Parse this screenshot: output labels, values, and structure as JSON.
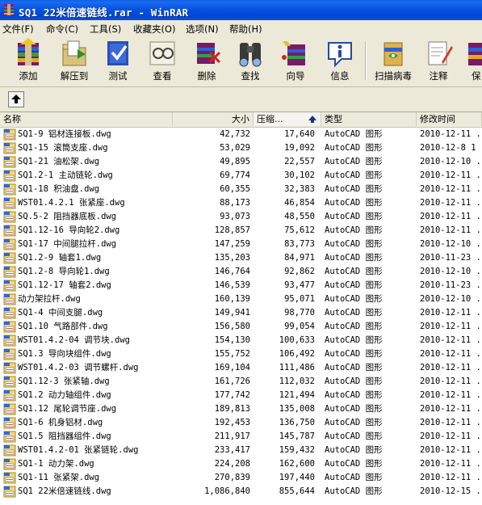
{
  "window": {
    "title": "SQ1  22米倍速链线.rar - WinRAR"
  },
  "menu": [
    {
      "label": "文件(F)"
    },
    {
      "label": "命令(C)"
    },
    {
      "label": "工具(S)"
    },
    {
      "label": "收藏夹(O)"
    },
    {
      "label": "选项(N)"
    },
    {
      "label": "帮助(H)"
    }
  ],
  "toolbar": [
    {
      "label": "添加",
      "icon": "add-archive-icon"
    },
    {
      "label": "解压到",
      "icon": "extract-to-icon"
    },
    {
      "label": "测试",
      "icon": "test-icon"
    },
    {
      "label": "查看",
      "icon": "view-icon"
    },
    {
      "label": "删除",
      "icon": "delete-icon"
    },
    {
      "label": "查找",
      "icon": "find-icon"
    },
    {
      "label": "向导",
      "icon": "wizard-icon"
    },
    {
      "label": "信息",
      "icon": "info-icon"
    },
    {
      "label": "扫描病毒",
      "icon": "virus-scan-icon"
    },
    {
      "label": "注释",
      "icon": "comment-icon"
    },
    {
      "label": "保",
      "icon": "protect-icon"
    }
  ],
  "columns": {
    "name": "名称",
    "size": "大小",
    "packed": "压缩...",
    "type": "类型",
    "modified": "修改时间"
  },
  "files": [
    {
      "name": "SQ1-9  铝材连接板.dwg",
      "size": "42,732",
      "packed": "17,640",
      "type": "AutoCAD 图形",
      "modified": "2010-12-11 ."
    },
    {
      "name": "SQ1-15  滚筒支座.dwg",
      "size": "53,029",
      "packed": "19,092",
      "type": "AutoCAD 图形",
      "modified": "2010-12-8 1"
    },
    {
      "name": "SQ1-21  油松架.dwg",
      "size": "49,895",
      "packed": "22,557",
      "type": "AutoCAD 图形",
      "modified": "2010-12-10 ."
    },
    {
      "name": "SQ1.2-1  主动链轮.dwg",
      "size": "69,774",
      "packed": "30,102",
      "type": "AutoCAD 图形",
      "modified": "2010-12-11 ."
    },
    {
      "name": "SQ1-18  积油盘.dwg",
      "size": "60,355",
      "packed": "32,383",
      "type": "AutoCAD 图形",
      "modified": "2010-12-11 ."
    },
    {
      "name": "WST01.4.2.1 张紧座.dwg",
      "size": "88,173",
      "packed": "46,854",
      "type": "AutoCAD 图形",
      "modified": "2010-12-11 ."
    },
    {
      "name": "SQ.5-2  阻挡器底板.dwg",
      "size": "93,073",
      "packed": "48,550",
      "type": "AutoCAD 图形",
      "modified": "2010-12-11 ."
    },
    {
      "name": "SQ1.12-16 导向轮2.dwg",
      "size": "128,857",
      "packed": "75,612",
      "type": "AutoCAD 图形",
      "modified": "2010-12-11 ."
    },
    {
      "name": "SQ1-17  中间腿拉杆.dwg",
      "size": "147,259",
      "packed": "83,773",
      "type": "AutoCAD 图形",
      "modified": "2010-12-10 ."
    },
    {
      "name": "SQ1.2-9  轴套1.dwg",
      "size": "135,203",
      "packed": "84,971",
      "type": "AutoCAD 图形",
      "modified": "2010-11-23 ."
    },
    {
      "name": "SQ1.2-8  导向轮1.dwg",
      "size": "146,764",
      "packed": "92,862",
      "type": "AutoCAD 图形",
      "modified": "2010-12-10 ."
    },
    {
      "name": "SQ1.12-17  轴套2.dwg",
      "size": "146,539",
      "packed": "93,477",
      "type": "AutoCAD 图形",
      "modified": "2010-11-23 ."
    },
    {
      "name": "动力架拉杆.dwg",
      "size": "160,139",
      "packed": "95,071",
      "type": "AutoCAD 图形",
      "modified": "2010-12-10 ."
    },
    {
      "name": "SQ1-4  中间支腿.dwg",
      "size": "149,941",
      "packed": "98,770",
      "type": "AutoCAD 图形",
      "modified": "2010-12-11 ."
    },
    {
      "name": "SQ1.10  气路部件.dwg",
      "size": "156,580",
      "packed": "99,054",
      "type": "AutoCAD 图形",
      "modified": "2010-12-11 ."
    },
    {
      "name": "WST01.4.2-04  调节块.dwg",
      "size": "154,130",
      "packed": "100,633",
      "type": "AutoCAD 图形",
      "modified": "2010-12-11 ."
    },
    {
      "name": "SQ1.3 导向块组件.dwg",
      "size": "155,752",
      "packed": "106,492",
      "type": "AutoCAD 图形",
      "modified": "2010-12-11 ."
    },
    {
      "name": "WST01.4.2-03 调节螺杆.dwg",
      "size": "169,104",
      "packed": "111,486",
      "type": "AutoCAD 图形",
      "modified": "2010-12-11 ."
    },
    {
      "name": " SQ1.12-3  张紧轴.dwg",
      "size": "161,726",
      "packed": "112,032",
      "type": "AutoCAD 图形",
      "modified": "2010-12-11 ."
    },
    {
      "name": "SQ1.2  动力轴组件.dwg",
      "size": "177,742",
      "packed": "121,494",
      "type": "AutoCAD 图形",
      "modified": "2010-12-11 ."
    },
    {
      "name": "SQ1.12  尾轮调节座.dwg",
      "size": "189,813",
      "packed": "135,008",
      "type": "AutoCAD 图形",
      "modified": "2010-12-11 ."
    },
    {
      "name": "SQ1-6 机身铝材.dwg",
      "size": "192,453",
      "packed": "136,750",
      "type": "AutoCAD 图形",
      "modified": "2010-12-11 ."
    },
    {
      "name": "SQ1.5  阻挡器组件.dwg",
      "size": "211,917",
      "packed": "145,787",
      "type": "AutoCAD 图形",
      "modified": "2010-12-11 ."
    },
    {
      "name": "WST01.4.2-01  张紧链轮.dwg",
      "size": "233,417",
      "packed": "159,432",
      "type": "AutoCAD 图形",
      "modified": "2010-12-11 ."
    },
    {
      "name": "SQ1-1  动力架.dwg",
      "size": "224,208",
      "packed": "162,600",
      "type": "AutoCAD 图形",
      "modified": "2010-12-11 ."
    },
    {
      "name": "SQ1-11 张紧架.dwg",
      "size": "270,839",
      "packed": "197,440",
      "type": "AutoCAD 图形",
      "modified": "2010-12-11 ."
    },
    {
      "name": "SQ1  22米倍速链线.dwg",
      "size": "1,086,840",
      "packed": "855,644",
      "type": "AutoCAD 图形",
      "modified": "2010-12-15 ."
    }
  ]
}
